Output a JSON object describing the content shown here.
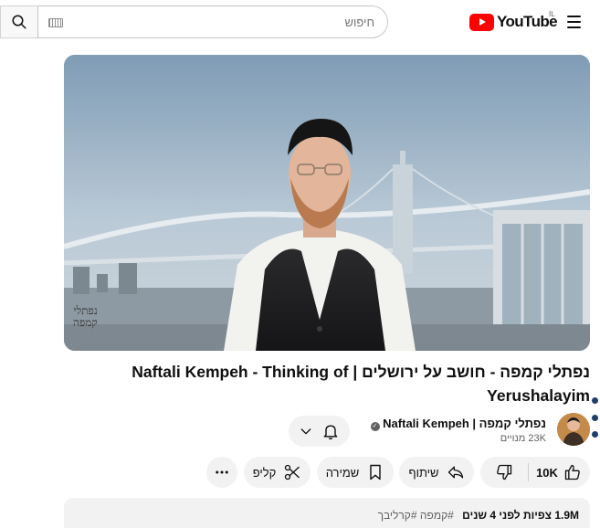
{
  "header": {
    "logo_text": "YouTube",
    "country_code": "IL",
    "search_placeholder": "חיפוש",
    "menu_icon": "hamburger-icon",
    "search_icon": "search-icon",
    "keyboard_icon": "keyboard-icon"
  },
  "player": {
    "watermark_line1": "נפתלי",
    "watermark_line2": "קמפה"
  },
  "video": {
    "title": "נפתלי קמפה - חושב על ירושלים | Naftali Kempeh - Thinking of Yerushalayim"
  },
  "channel": {
    "name": "נפתלי קמפה | Naftali Kempeh",
    "subscribers": "23K מנויים",
    "verified_icon": "verified-check-icon"
  },
  "actions": {
    "like_count": "10K",
    "share_label": "שיתוף",
    "save_label": "שמירה",
    "clip_label": "קליפ"
  },
  "description": {
    "views": "1.9M צפיות",
    "age": "לפני 4 שנים",
    "hashtags": "#קמפה #קרליבך"
  },
  "colors": {
    "brand_red": "#ff0000",
    "pill_bg": "#f2f2f2",
    "text": "#0f0f0f",
    "secondary_text": "#606060"
  }
}
